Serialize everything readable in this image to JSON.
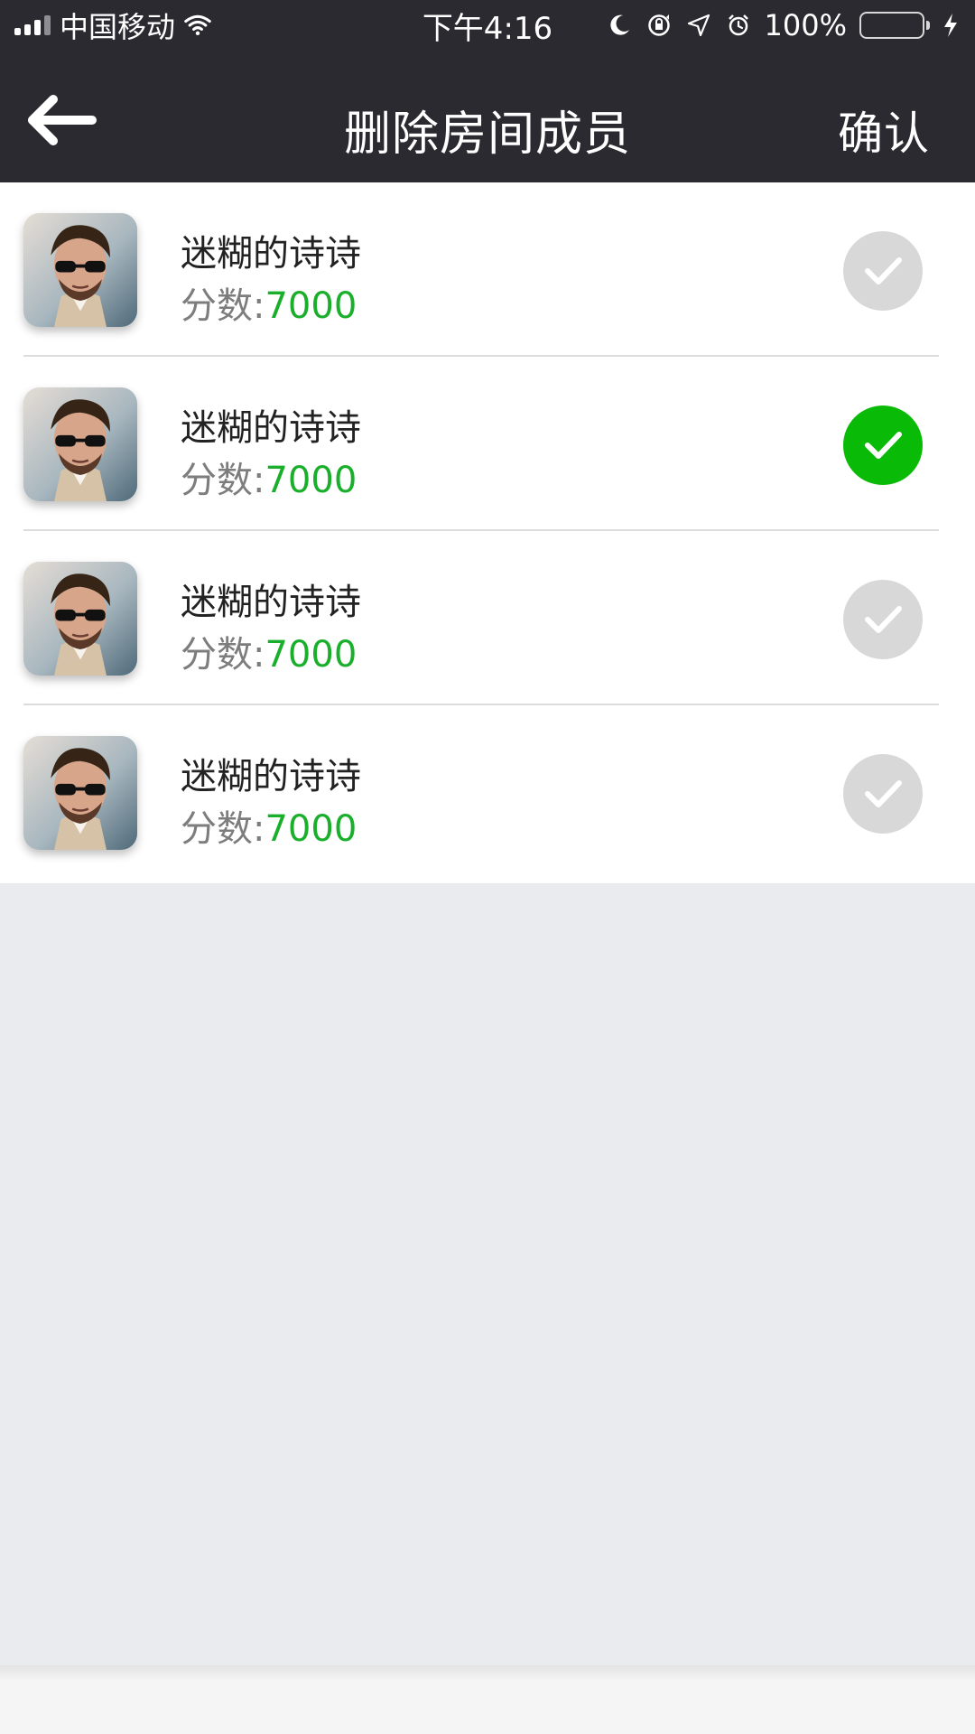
{
  "status_bar": {
    "carrier": "中国移动",
    "time": "下午4:16",
    "battery_percent": "100%",
    "icons": [
      "signal-icon",
      "wifi-icon",
      "moon-icon",
      "rotation-lock-icon",
      "location-icon",
      "alarm-icon",
      "battery-icon",
      "charging-icon"
    ]
  },
  "navbar": {
    "title": "删除房间成员",
    "confirm_label": "确认",
    "back_icon": "arrow-left-icon"
  },
  "members": [
    {
      "name": "迷糊的诗诗",
      "score_label": "分数:",
      "score_value": "7000",
      "selected": false
    },
    {
      "name": "迷糊的诗诗",
      "score_label": "分数:",
      "score_value": "7000",
      "selected": true
    },
    {
      "name": "迷糊的诗诗",
      "score_label": "分数:",
      "score_value": "7000",
      "selected": false
    },
    {
      "name": "迷糊的诗诗",
      "score_label": "分数:",
      "score_value": "7000",
      "selected": false
    }
  ],
  "colors": {
    "header_bg": "#2b2a30",
    "selected_check": "#09bb07",
    "unselected_check": "#d8d8d8",
    "score_value": "#1aaf2b",
    "page_bg": "#eaebef"
  }
}
